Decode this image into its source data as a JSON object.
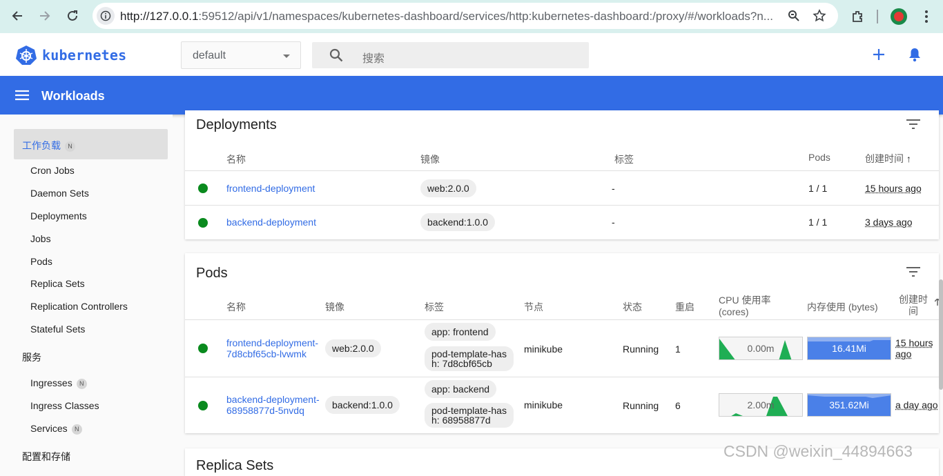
{
  "browser": {
    "url_host": "http://127.0.0.1",
    "url_rest": ":59512/api/v1/namespaces/kubernetes-dashboard/services/http:kubernetes-dashboard:/proxy/#/workloads?n..."
  },
  "header": {
    "logo_text": "kubernetes",
    "namespace": "default",
    "search_placeholder": "搜索"
  },
  "toolbar": {
    "title": "Workloads"
  },
  "sidebar": {
    "active_group": "工作负载",
    "active_badge": "N",
    "workload_items": [
      "Cron Jobs",
      "Daemon Sets",
      "Deployments",
      "Jobs",
      "Pods",
      "Replica Sets",
      "Replication Controllers",
      "Stateful Sets"
    ],
    "services_head": "服务",
    "services_items": [
      {
        "label": "Ingresses",
        "badge": "N"
      },
      {
        "label": "Ingress Classes",
        "badge": ""
      },
      {
        "label": "Services",
        "badge": "N"
      }
    ],
    "config_head": "配置和存储"
  },
  "deployments": {
    "title": "Deployments",
    "columns": [
      "名称",
      "镜像",
      "标签",
      "Pods",
      "创建时间"
    ],
    "sort_arrow": "↑",
    "rows": [
      {
        "name": "frontend-deployment",
        "image": "web:2.0.0",
        "labels": "-",
        "pods": "1 / 1",
        "created": "15 hours ago"
      },
      {
        "name": "backend-deployment",
        "image": "backend:1.0.0",
        "labels": "-",
        "pods": "1 / 1",
        "created": "3 days ago"
      }
    ]
  },
  "pods": {
    "title": "Pods",
    "columns": {
      "name": "名称",
      "image": "镜像",
      "labels": "标签",
      "node": "节点",
      "status": "状态",
      "restarts": "重启",
      "cpu_1": "CPU 使用率",
      "cpu_2": "(cores)",
      "mem": "内存使用 (bytes)",
      "created_1": "创建时",
      "created_2": "间"
    },
    "rows": [
      {
        "name_1": "frontend-deployment-",
        "name_2": "7d8cbf65cb-lvwmk",
        "image": "web:2.0.0",
        "label_a": "app: frontend",
        "label_b_1": "pod-template-has",
        "label_b_2": "h: 7d8cbf65cb",
        "node": "minikube",
        "status": "Running",
        "restarts": "1",
        "cpu": "0.00m",
        "mem": "16.41Mi",
        "created_1": "15 hours",
        "created_2": "ago"
      },
      {
        "name_1": "backend-deployment-",
        "name_2": "68958877d-5nvdq",
        "image": "backend:1.0.0",
        "label_a": "app: backend",
        "label_b_1": "pod-template-has",
        "label_b_2": "h: 68958877d",
        "node": "minikube",
        "status": "Running",
        "restarts": "6",
        "cpu": "2.00m",
        "mem": "351.62Mi",
        "created_1": "a day ago",
        "created_2": ""
      }
    ]
  },
  "next_card_title": "Replica Sets",
  "watermark": "CSDN @weixin_44894663",
  "colors": {
    "brand": "#326ce5",
    "running": "#0a8a1e",
    "spark_green": "#1fae54",
    "chrome": "#d9f0ee"
  }
}
